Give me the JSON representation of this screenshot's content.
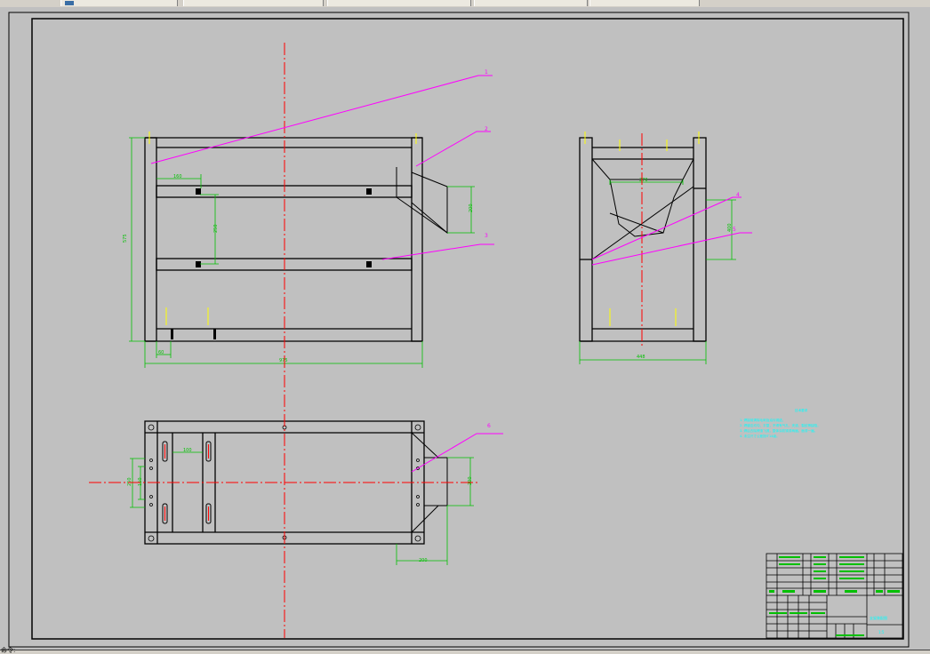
{
  "window": {
    "tabs": [
      {
        "name": "tab-1"
      },
      {
        "name": "tab-2"
      },
      {
        "name": "tab-3"
      },
      {
        "name": "tab-4"
      },
      {
        "name": "tab-5"
      }
    ]
  },
  "drawing": {
    "balloons": [
      "1",
      "2",
      "3",
      "4",
      "5",
      "6"
    ],
    "dims": {
      "front_height": "575",
      "front_width": "975",
      "front_small": "60",
      "front_top_offset": "160",
      "front_gap": "250",
      "front_hopper": "200",
      "side_width": "448",
      "side_inner": "270",
      "side_right": "400",
      "plan_hopper": "200",
      "plan_left": "250",
      "plan_left2": "150",
      "plan_slot": "100",
      "plan_bottom": "200"
    },
    "notes_title": "技术要求",
    "notes": [
      "1. 焊接前清除毛刺及油污锈迹。",
      "2. 焊缝应均匀、平整，不得有气孔、夹渣、裂纹等缺陷。",
      "3. 焊后去除焊渣飞溅，整体涂防锈漆两遍，面漆一遍。",
      "4. 未注尺寸公差按IT14级。"
    ],
    "title_block": {
      "drawing_name": "支架装配图",
      "scale": "1:5"
    }
  },
  "statusbar": {
    "text": "命令:"
  },
  "colors": {
    "background": "#c0c0c0",
    "geometry": "#000000",
    "centerline": "#ff0000",
    "dimension": "#00c000",
    "leader": "#ff00ff",
    "text_cyan": "#00ffff",
    "thread": "#ffff00"
  }
}
